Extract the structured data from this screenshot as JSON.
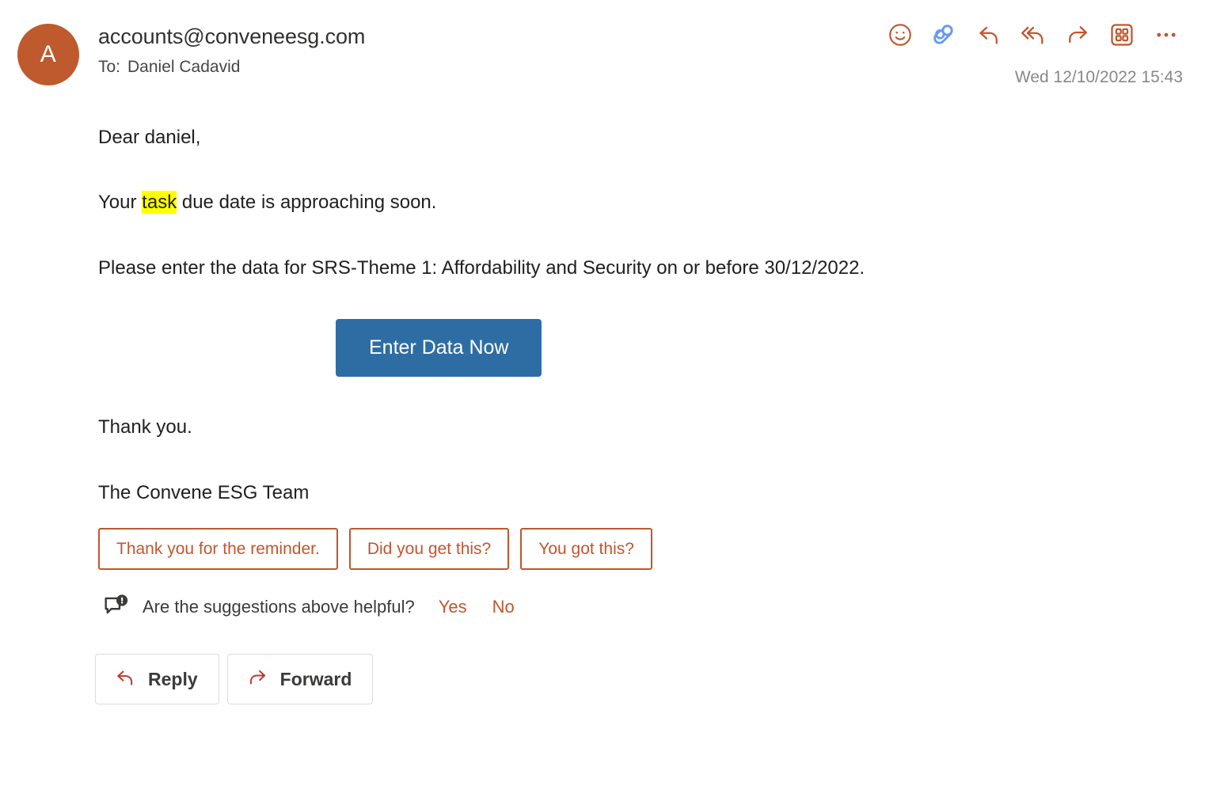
{
  "colors": {
    "accent_orange": "#c1562e",
    "avatar_bg": "#be5a2d",
    "cta_blue": "#2e6da4",
    "viva_blue": "#6699f0",
    "highlight_yellow": "#ffff00"
  },
  "header": {
    "avatar_initial": "A",
    "sender_email": "accounts@conveneesg.com",
    "to_label": "To:",
    "to_recipient": "Daniel Cadavid",
    "timestamp": "Wed 12/10/2022 15:43",
    "actions": [
      {
        "name": "react-smiley-icon",
        "title": "React"
      },
      {
        "name": "viva-insights-icon",
        "title": "Viva Insights"
      },
      {
        "name": "reply-icon",
        "title": "Reply"
      },
      {
        "name": "reply-all-icon",
        "title": "Reply all"
      },
      {
        "name": "forward-icon",
        "title": "Forward"
      },
      {
        "name": "apps-grid-icon",
        "title": "Apps"
      },
      {
        "name": "more-options-icon",
        "title": "More actions"
      }
    ]
  },
  "body": {
    "greeting": "Dear daniel,",
    "task_line_before": "Your ",
    "task_line_highlight": "task",
    "task_line_after": " due date is approaching soon.",
    "instruction": "Please enter the data for SRS-Theme 1: Affordability and Security on or before 30/12/2022.",
    "cta_label": "Enter Data Now",
    "closing": "Thank you.",
    "signature": "The Convene ESG Team"
  },
  "suggested_replies": {
    "chips": [
      {
        "label": "Thank you for the reminder."
      },
      {
        "label": "Did you get this?"
      },
      {
        "label": "You got this?"
      }
    ]
  },
  "feedback": {
    "question": "Are the suggestions above helpful?",
    "yes_label": "Yes",
    "no_label": "No"
  },
  "footer": {
    "reply_label": "Reply",
    "forward_label": "Forward"
  }
}
